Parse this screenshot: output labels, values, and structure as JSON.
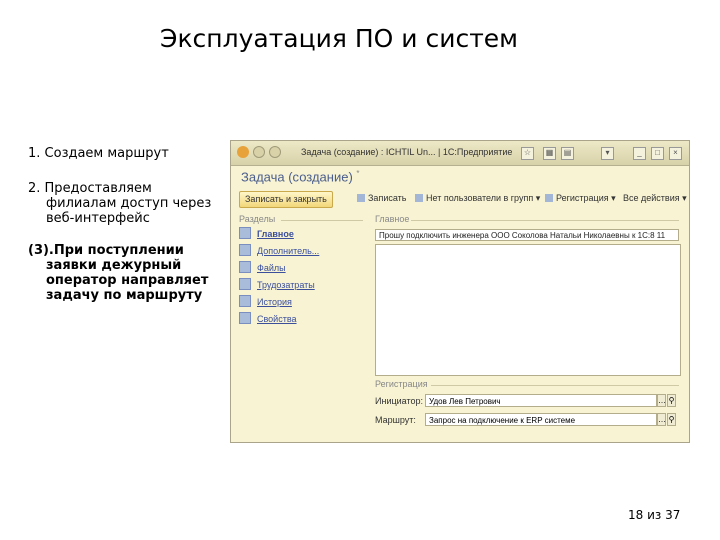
{
  "slide": {
    "title": "Эксплуатация ПО и систем",
    "bullets": [
      {
        "lines": [
          "1. Создаем маршрут"
        ]
      },
      {
        "lines": [
          "2. Предоставляем",
          "филиалам доступ через",
          "веб-интерфейс"
        ]
      },
      {
        "lines": [
          "(3).При поступлении",
          "заявки дежурный",
          "оператор направляет",
          "задачу по маршруту"
        ]
      }
    ],
    "page": "18 из 37"
  },
  "window": {
    "title": "Задача (создание) : ICHTIL Un... | 1С:Предприятие",
    "form_title": "Задача (создание)",
    "form_title_mark": "*",
    "toolbar": {
      "save_close": "Записать и закрыть",
      "save": "Записать",
      "not_used": "Нет пользователи в групп",
      "registration": "Регистрация",
      "actions": "Все действия"
    },
    "sidebar": {
      "label": "Разделы",
      "items": [
        "Главное",
        "Дополнитель...",
        "Файлы",
        "Трудозатраты",
        "История",
        "Свойства"
      ]
    },
    "main": {
      "label": "Главное",
      "subject": "Прошу подключить инженера ООО Соколова Натальи Николаевны к 1С:8 11"
    },
    "registration": {
      "label": "Регистрация",
      "initiator_label": "Инициатор:",
      "initiator_value": "Удов Лев Петрович",
      "route_label": "Маршрут:",
      "route_value": "Запрос на подключение к ERP системе"
    }
  }
}
